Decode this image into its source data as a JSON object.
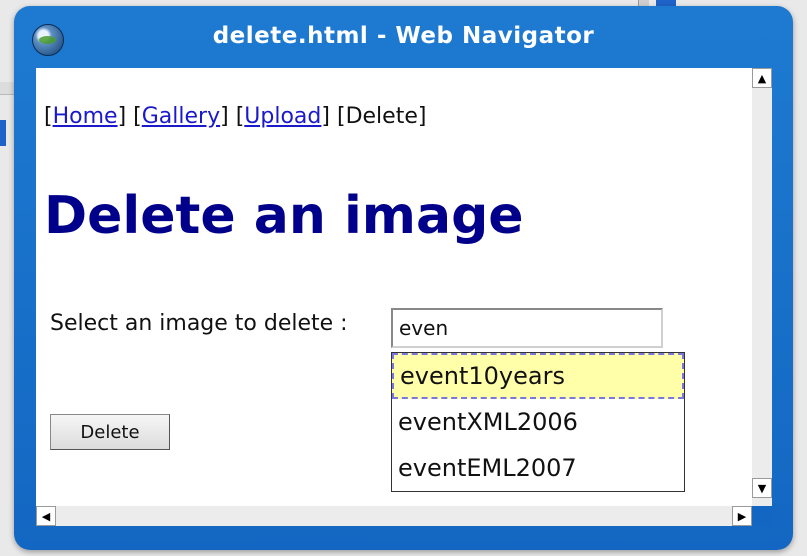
{
  "window": {
    "title": "delete.html - Web Navigator",
    "icon": "globe-icon"
  },
  "nav": {
    "open_bracket": "[",
    "close_bracket": "]",
    "links": [
      "Home",
      "Gallery",
      "Upload"
    ],
    "current": "Delete"
  },
  "page": {
    "heading": "Delete an image",
    "label": "Select an image to delete :",
    "delete_button": "Delete"
  },
  "search": {
    "value": "even",
    "suggestions": [
      "event10years",
      "eventXML2006",
      "eventEML2007"
    ]
  },
  "scrollbars": {
    "up_arrow": "▲",
    "down_arrow": "▼",
    "left_arrow": "◀",
    "right_arrow": "▶"
  }
}
